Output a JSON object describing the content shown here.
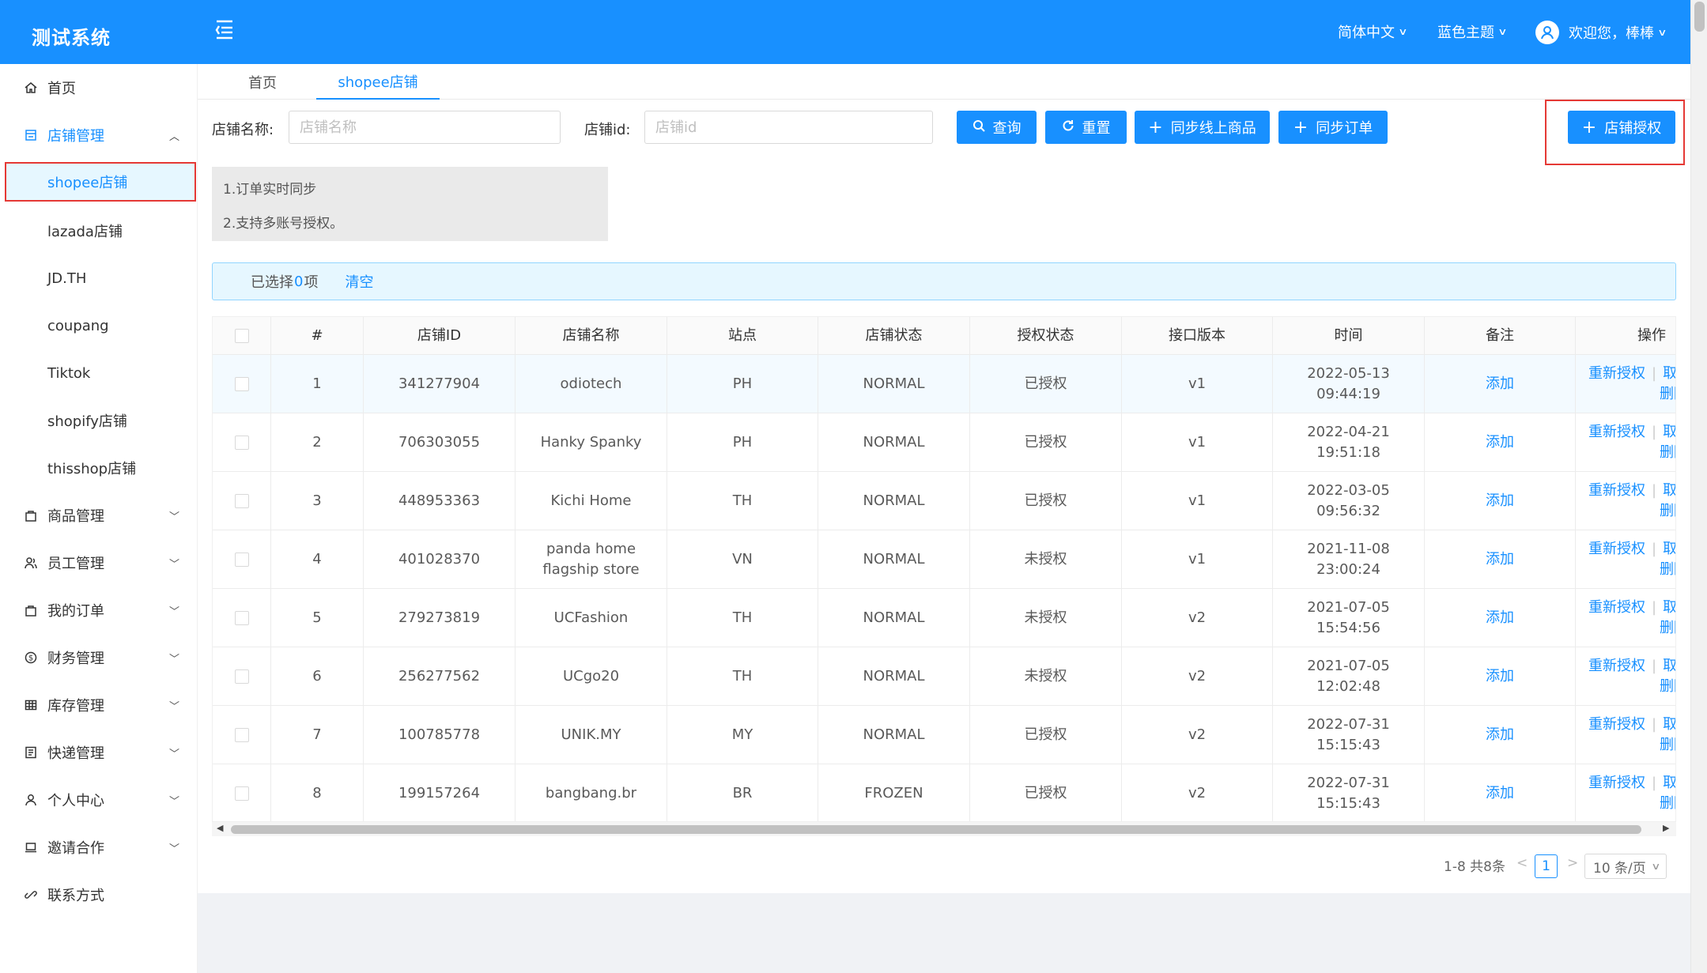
{
  "app": {
    "title": "测试系统"
  },
  "header": {
    "language": "简体中文",
    "theme": "蓝色主题",
    "user": "欢迎您，棒棒"
  },
  "sidebar": {
    "home": "首页",
    "store_mgmt": "店铺管理",
    "store_children": [
      "shopee店铺",
      "lazada店铺",
      "JD.TH",
      "coupang",
      "Tiktok",
      "shopify店铺",
      "thisshop店铺"
    ],
    "others": [
      "商品管理",
      "员工管理",
      "我的订单",
      "财务管理",
      "库存管理",
      "快递管理",
      "个人中心",
      "邀请合作",
      "联系方式"
    ]
  },
  "tabs": [
    "首页",
    "shopee店铺"
  ],
  "filters": {
    "name_label": "店铺名称:",
    "name_placeholder": "店铺名称",
    "id_label": "店铺id:",
    "id_placeholder": "店铺id"
  },
  "buttons": {
    "query": "查询",
    "reset": "重置",
    "sync_products": "同步线上商品",
    "sync_orders": "同步订单",
    "authorize": "店铺授权"
  },
  "notice": [
    "1.订单实时同步",
    "2.支持多账号授权。"
  ],
  "selection": {
    "prefix": "已选择",
    "count": "0",
    "suffix": "项",
    "clear": "清空"
  },
  "table": {
    "columns": [
      "#",
      "店铺ID",
      "店铺名称",
      "站点",
      "店铺状态",
      "授权状态",
      "接口版本",
      "时间",
      "备注",
      "操作"
    ],
    "rows": [
      {
        "idx": "1",
        "id": "341277904",
        "name": "odiotech",
        "site": "PH",
        "status": "NORMAL",
        "auth": "已授权",
        "ver": "v1",
        "time": "2022-05-13 09:44:19",
        "note": "添加"
      },
      {
        "idx": "2",
        "id": "706303055",
        "name": "Hanky Spanky",
        "site": "PH",
        "status": "NORMAL",
        "auth": "已授权",
        "ver": "v1",
        "time": "2022-04-21 19:51:18",
        "note": "添加"
      },
      {
        "idx": "3",
        "id": "448953363",
        "name": "Kichi Home",
        "site": "TH",
        "status": "NORMAL",
        "auth": "已授权",
        "ver": "v1",
        "time": "2022-03-05 09:56:32",
        "note": "添加"
      },
      {
        "idx": "4",
        "id": "401028370",
        "name": "panda home flagship store",
        "site": "VN",
        "status": "NORMAL",
        "auth": "未授权",
        "ver": "v1",
        "time": "2021-11-08 23:00:24",
        "note": "添加"
      },
      {
        "idx": "5",
        "id": "279273819",
        "name": "UCFashion",
        "site": "TH",
        "status": "NORMAL",
        "auth": "未授权",
        "ver": "v2",
        "time": "2021-07-05 15:54:56",
        "note": "添加"
      },
      {
        "idx": "6",
        "id": "256277562",
        "name": "UCgo20",
        "site": "TH",
        "status": "NORMAL",
        "auth": "未授权",
        "ver": "v2",
        "time": "2021-07-05 12:02:48",
        "note": "添加"
      },
      {
        "idx": "7",
        "id": "100785778",
        "name": "UNIK.MY",
        "site": "MY",
        "status": "NORMAL",
        "auth": "已授权",
        "ver": "v2",
        "time": "2022-07-31 15:15:43",
        "note": "添加"
      },
      {
        "idx": "8",
        "id": "199157264",
        "name": "bangbang.br",
        "site": "BR",
        "status": "FROZEN",
        "auth": "已授权",
        "ver": "v2",
        "time": "2022-07-31 15:15:43",
        "note": "添加"
      }
    ],
    "ops": {
      "reauth": "重新授权",
      "cancel": "取消授权",
      "delete": "删除"
    }
  },
  "pagination": {
    "summary": "1-8 共8条",
    "current": "1",
    "page_size": "10 条/页"
  }
}
